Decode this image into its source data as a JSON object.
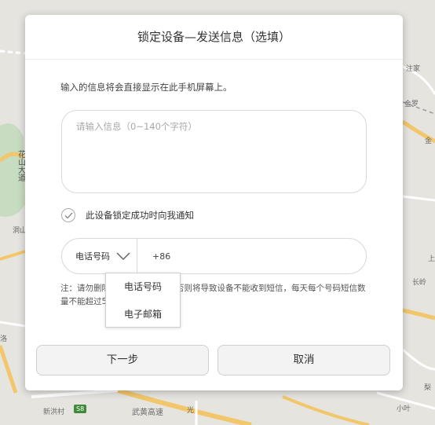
{
  "map": {
    "labels_right": [
      "注家",
      "金罗",
      "金",
      "长岭",
      "梨",
      "小叶",
      "上"
    ],
    "labels_left": [
      "洞山"
    ],
    "vertical_left": "花山大道",
    "bottom_labels": [
      "新洪村",
      "武黄高速",
      "光谷"
    ],
    "road_badge": "S8",
    "bottom_edge": "光",
    "left_edge": "洛"
  },
  "dialog": {
    "title": "锁定设备—发送信息（选填）",
    "hint": "输入的信息将会直接显示在此手机屏幕上。",
    "message_placeholder": "请输入信息（0~140个字符）",
    "notify_label": "此设备锁定成功时向我通知",
    "phone_type_label": "电话号码",
    "phone_value": "+86",
    "note": "注：请勿删除或修改手机号码，否则将导致设备不能收到短信，每天每个号码短信数量不能超过5条。",
    "dropdown_options": [
      "电话号码",
      "电子邮箱"
    ],
    "next_label": "下一步",
    "cancel_label": "取消"
  }
}
